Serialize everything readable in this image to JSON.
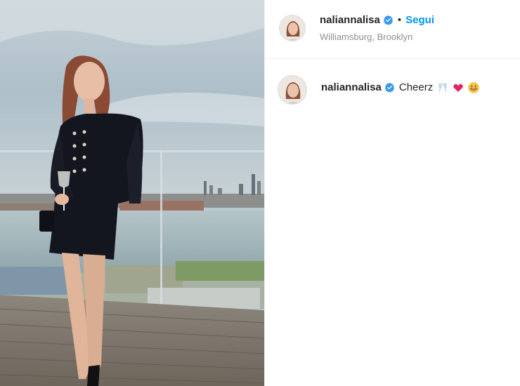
{
  "post": {
    "author": {
      "username": "naliannalisa",
      "verified": true,
      "follow_label": "Segui",
      "separator": "•",
      "location": "Williamsburg, Brooklyn"
    },
    "comment": {
      "username": "naliannalisa",
      "verified": true,
      "text": "Cheerz"
    },
    "emojis": [
      "champagne-glasses-icon",
      "sparkling-heart-icon",
      "grinning-face-icon"
    ],
    "colors": {
      "link": "#0095f6",
      "verified": "#3897f0",
      "text": "#262626",
      "muted": "#8e8e8e",
      "border": "#efefef"
    }
  }
}
